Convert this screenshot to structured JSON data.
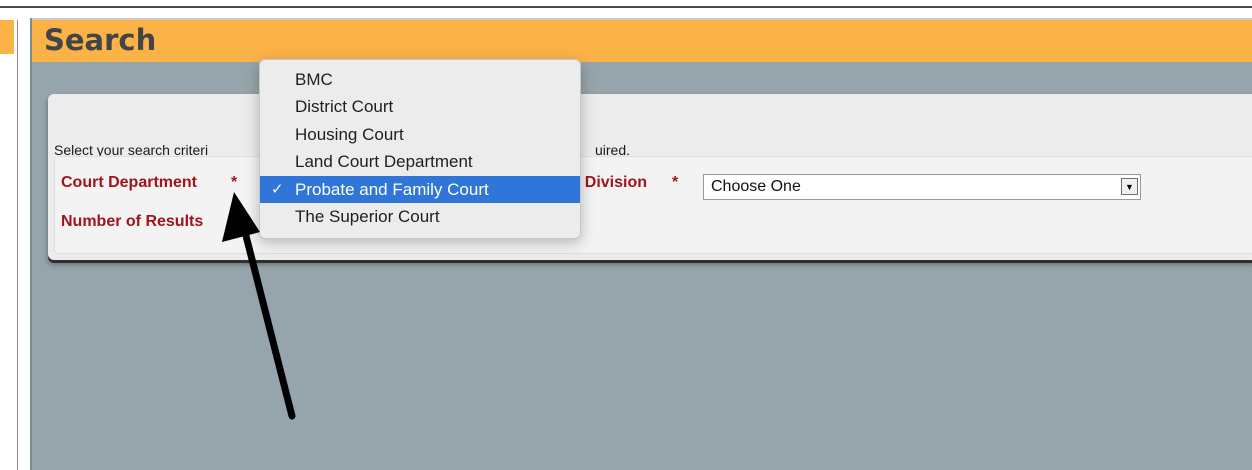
{
  "header": {
    "title": "Search"
  },
  "form": {
    "instructions_left": "Select your search criteri",
    "instructions_right": "uired.",
    "court_department_label": "Court Department",
    "court_division_label": "t Division",
    "required_marker": "*",
    "number_of_results_label": "Number of Results",
    "division_select_value": "Choose One",
    "select_arrow_glyph": "▼"
  },
  "dropdown": {
    "items": [
      {
        "label": "BMC",
        "selected": false
      },
      {
        "label": "District Court",
        "selected": false
      },
      {
        "label": "Housing Court",
        "selected": false
      },
      {
        "label": "Land Court Department",
        "selected": false
      },
      {
        "label": "Probate and Family Court",
        "selected": true
      },
      {
        "label": "The Superior Court",
        "selected": false
      }
    ],
    "check_glyph": "✓"
  },
  "colors": {
    "header_bg": "#fbb347",
    "panel_bg": "#96a5ab",
    "label_red": "#a0141b",
    "selection_blue": "#2f76d8",
    "annotation_arrow": "#000000"
  }
}
